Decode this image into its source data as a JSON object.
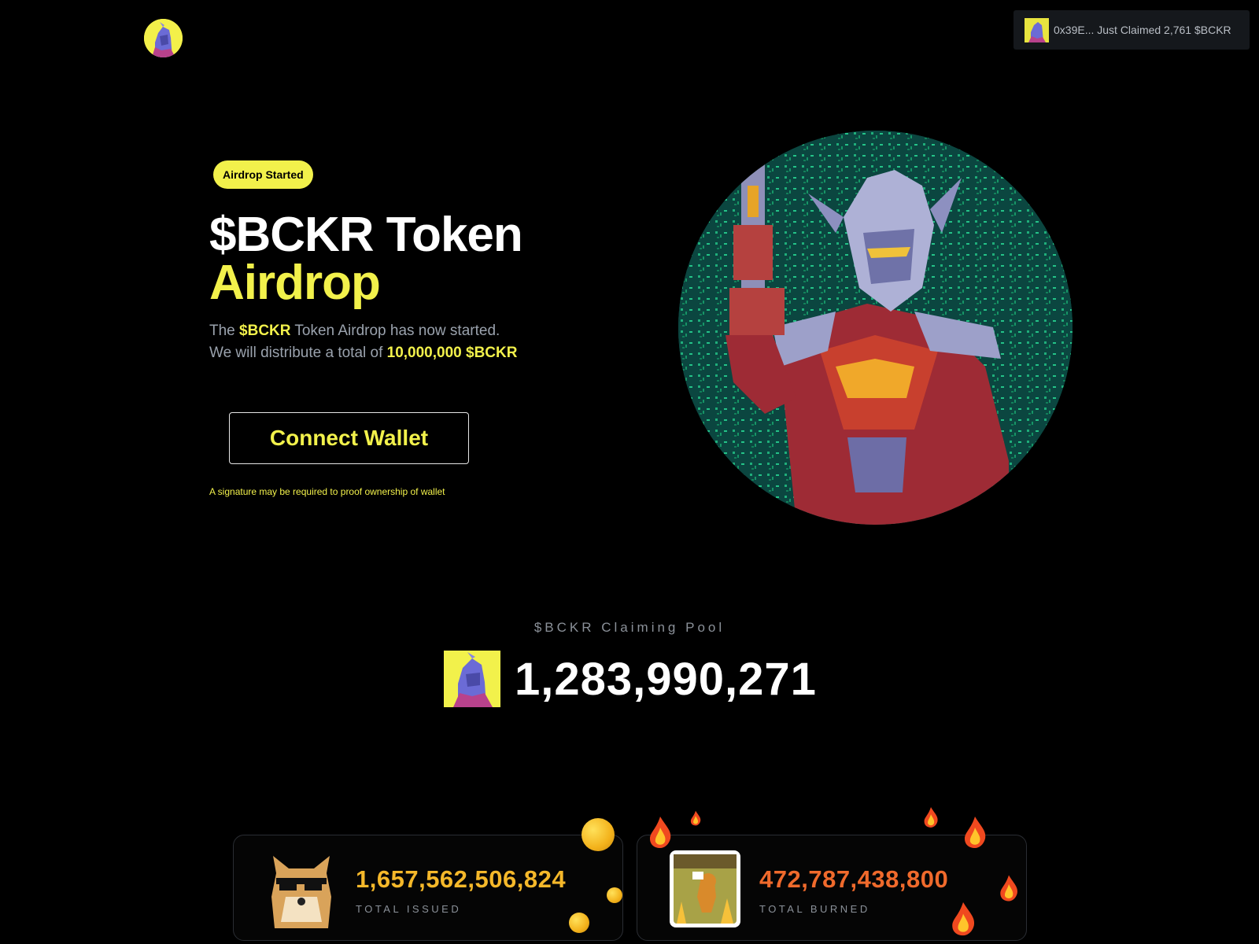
{
  "header": {
    "logo_icon": "warrior-avatar-icon",
    "toast": {
      "text": "0x39E... Just Claimed 2,761 $BCKR",
      "thumb_icon": "warrior-avatar-icon"
    }
  },
  "hero": {
    "badge": "Airdrop Started",
    "title_line1": "$BCKR Token",
    "title_line2": "Airdrop",
    "desc": {
      "p1_pre": "The ",
      "p1_token": "$BCKR",
      "p1_post": " Token Airdrop has now started.",
      "p2_pre": "We will distribute a total of ",
      "p2_amount": "10,000,000 $BCKR"
    },
    "connect_label": "Connect Wallet",
    "note": "A signature may be required to proof ownership of wallet",
    "image_icon": "armored-warrior-illustration"
  },
  "pool": {
    "label": "$BCKR Claiming Pool",
    "value": "1,283,990,271",
    "icon": "warrior-avatar-icon"
  },
  "stats": [
    {
      "value": "1,657,562,506,824",
      "label": "TOTAL ISSUED",
      "icon": "doge-sunglasses-icon"
    },
    {
      "value": "472,787,438,800",
      "label": "TOTAL BURNED",
      "icon": "this-is-fine-dog-icon"
    }
  ],
  "colors": {
    "accent": "#f2f14b",
    "issued": "#f5b82a",
    "burned": "#f06a2c",
    "background": "#000000",
    "muted": "#8b9199"
  }
}
